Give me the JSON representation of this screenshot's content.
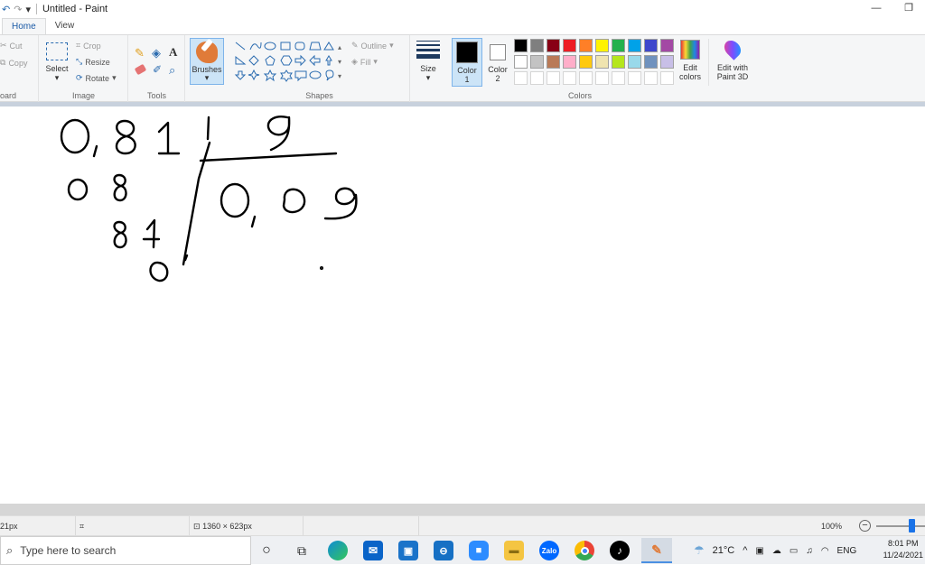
{
  "window": {
    "title": "Untitled - Paint",
    "undo_icon": "undo-icon",
    "redo_icon": "redo-icon",
    "customize_icon": "chevron-down-icon",
    "minimize_glyph": "—",
    "restore_glyph": "❐"
  },
  "tabs": [
    {
      "label": "Home",
      "active": true
    },
    {
      "label": "View",
      "active": false
    }
  ],
  "ribbon": {
    "clipboard": {
      "cut_label": "Cut",
      "copy_label": "Copy",
      "group_label": "oard"
    },
    "image": {
      "select_label": "Select",
      "crop_label": "Crop",
      "resize_label": "Resize",
      "rotate_label": "Rotate",
      "group_label": "Image"
    },
    "tools": {
      "group_label": "Tools",
      "text_glyph": "A"
    },
    "brushes": {
      "label": "Brushes"
    },
    "shapes": {
      "outline_label": "Outline",
      "fill_label": "Fill",
      "group_label": "Shapes"
    },
    "size": {
      "label": "Size"
    },
    "colors": {
      "color1_label_a": "Color",
      "color1_label_b": "1",
      "color2_label_a": "Color",
      "color2_label_b": "2",
      "edit_colors_a": "Edit",
      "edit_colors_b": "colors",
      "paint3d_a": "Edit with",
      "paint3d_b": "Paint 3D",
      "group_label": "Colors",
      "color1": "#000000",
      "color2": "#ffffff",
      "palette_row1": [
        "#000000",
        "#7f7f7f",
        "#880015",
        "#ed1c24",
        "#ff7f27",
        "#fff200",
        "#22b14c",
        "#00a2e8",
        "#3f48cc",
        "#a349a4"
      ],
      "palette_row2": [
        "#ffffff",
        "#c3c3c3",
        "#b97a57",
        "#ffaec9",
        "#ffc90e",
        "#efe4b0",
        "#b5e61d",
        "#99d9ea",
        "#7092be",
        "#c8bfe7"
      ]
    }
  },
  "status": {
    "position": "21px",
    "canvas_size": "1360 × 623px",
    "zoom": "100%",
    "zoom_level": 0.72
  },
  "taskbar": {
    "search_placeholder": "Type here to search",
    "zalo_label": "Zalo",
    "temperature": "21°C",
    "language": "ENG",
    "time": "8:01 PM",
    "date": "11/24/2021"
  }
}
